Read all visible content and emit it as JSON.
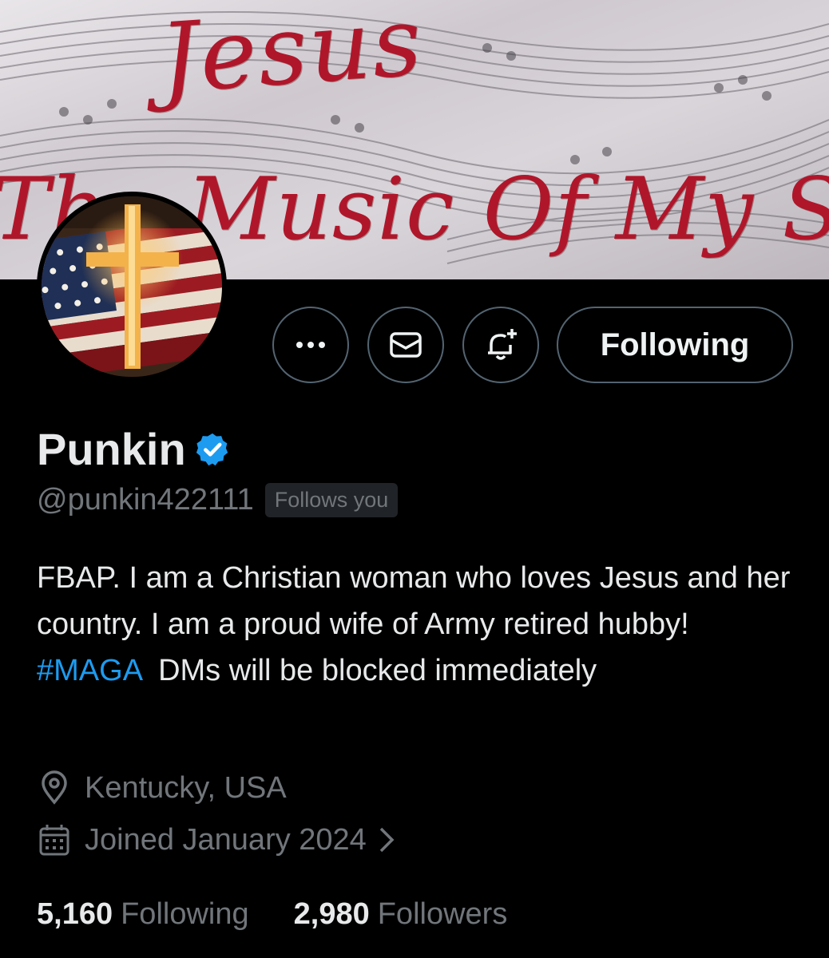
{
  "banner": {
    "title_text": "Jesus",
    "subtitle_text": "The Music Of My Soul"
  },
  "actions": {
    "follow_label": "Following"
  },
  "profile": {
    "display_name": "Punkin",
    "handle": "@punkin422111",
    "follows_you_label": "Follows you",
    "bio_part1": "FBAP. I am a Christian woman who loves Jesus and her country. I am a proud wife of Army retired hubby! ",
    "bio_hashtag": "#MAGA",
    "bio_part2": "  DMs will be blocked immediately",
    "location": "Kentucky, USA",
    "joined": "Joined January 2024"
  },
  "stats": {
    "following_count": "5,160",
    "following_label": "Following",
    "followers_count": "2,980",
    "followers_label": "Followers"
  },
  "colors": {
    "background": "#000000",
    "accent_blue": "#1d9bf0",
    "secondary_text": "#71767b",
    "banner_script_red": "#b0162a"
  },
  "icons": [
    "more-icon",
    "mail-icon",
    "bell-plus-icon",
    "verified-badge-icon",
    "location-pin-icon",
    "calendar-icon",
    "chevron-right-icon"
  ]
}
